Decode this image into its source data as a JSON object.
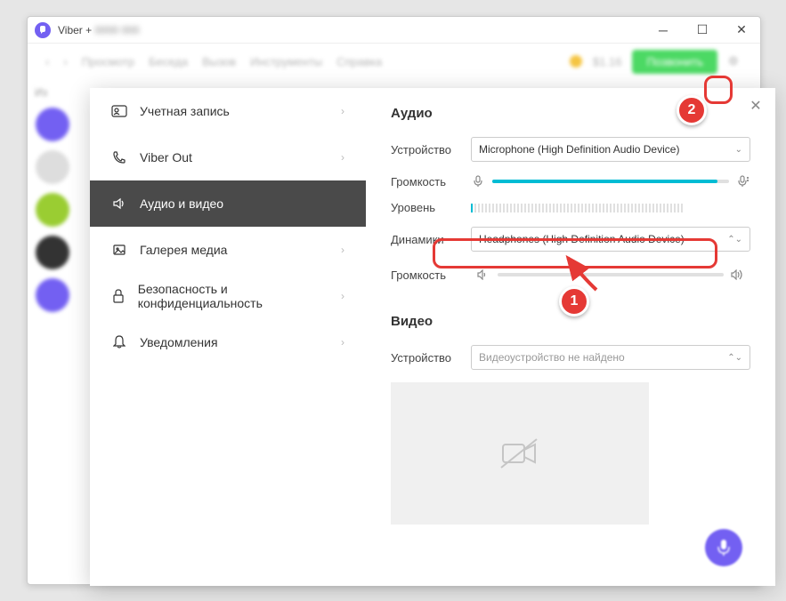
{
  "titlebar": {
    "app": "Viber +"
  },
  "bgmenu": {
    "items": [
      "Просмотр",
      "Беседа",
      "Вызов",
      "Инструменты",
      "Справка"
    ],
    "balance": "$1.16",
    "cta": "Позвонить"
  },
  "nav": {
    "items": [
      {
        "label": "Учетная запись"
      },
      {
        "label": "Viber Out"
      },
      {
        "label": "Аудио и видео"
      },
      {
        "label": "Галерея медиа"
      },
      {
        "label": "Безопасность и конфиденциальность"
      },
      {
        "label": "Уведомления"
      }
    ]
  },
  "audio": {
    "title": "Аудио",
    "device_label": "Устройство",
    "device_value": "Microphone (High Definition Audio Device)",
    "volume_label": "Громкость",
    "mic_volume_pct": 95,
    "level_label": "Уровень",
    "speakers_label": "Динамики",
    "speakers_value": "Headphones (High Definition Audio Device)",
    "spk_volume_label": "Громкость",
    "spk_volume_pct": 0
  },
  "video": {
    "title": "Видео",
    "device_label": "Устройство",
    "device_value": "Видеоустройство не найдено"
  },
  "callouts": {
    "one": "1",
    "two": "2"
  }
}
